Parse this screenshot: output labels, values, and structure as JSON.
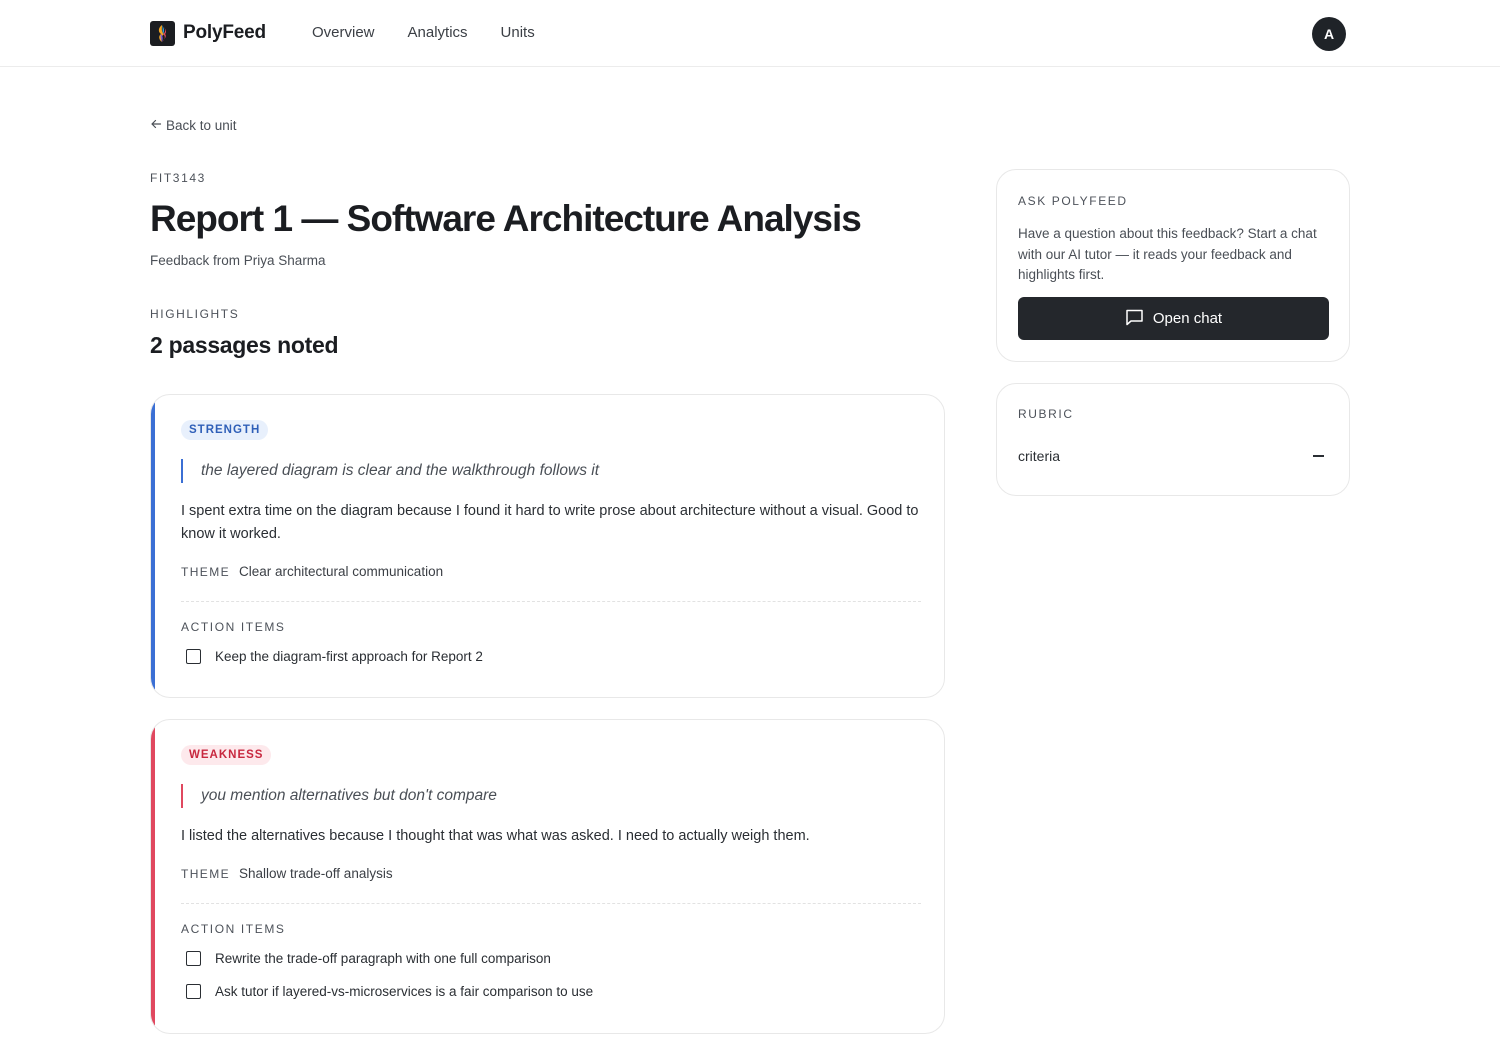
{
  "header": {
    "brand": "PolyFeed",
    "nav": [
      "Overview",
      "Analytics",
      "Units"
    ],
    "avatar_initial": "A"
  },
  "main": {
    "back_label": "Back to unit",
    "unit_code": "FIT3143",
    "title": "Report 1 — Software Architecture Analysis",
    "subtitle": "Feedback from Priya Sharma",
    "highlights_label": "HIGHLIGHTS",
    "highlights_count": "2 passages noted",
    "theme_label": "THEME",
    "action_items_label": "ACTION ITEMS",
    "cards": [
      {
        "type": "STRENGTH",
        "color": "#3b6fd4",
        "badge_bg": "#e8f0fc",
        "badge_color": "#2f5fb8",
        "quote": "the layered diagram is clear and the walkthrough follows it",
        "reflection": "I spent extra time on the diagram because I found it hard to write prose about architecture without a visual. Good to know it worked.",
        "theme": "Clear architectural communication",
        "action_items": [
          "Keep the diagram-first approach for Report 2"
        ]
      },
      {
        "type": "WEAKNESS",
        "color": "#e0485f",
        "badge_bg": "#fde9ec",
        "badge_color": "#c8283f",
        "quote": "you mention alternatives but don't compare",
        "reflection": "I listed the alternatives because I thought that was what was asked. I need to actually weigh them.",
        "theme": "Shallow trade-off analysis",
        "action_items": [
          "Rewrite the trade-off paragraph with one full comparison",
          "Ask tutor if layered-vs-microservices is a fair comparison to use"
        ]
      }
    ]
  },
  "sidebar": {
    "ask_label": "ASK POLYFEED",
    "ask_text": "Have a question about this feedback? Start a chat with our AI tutor — it reads your feedback and highlights first.",
    "chat_button": "Open chat",
    "rubric_label": "RUBRIC",
    "rubric_item": "criteria"
  }
}
